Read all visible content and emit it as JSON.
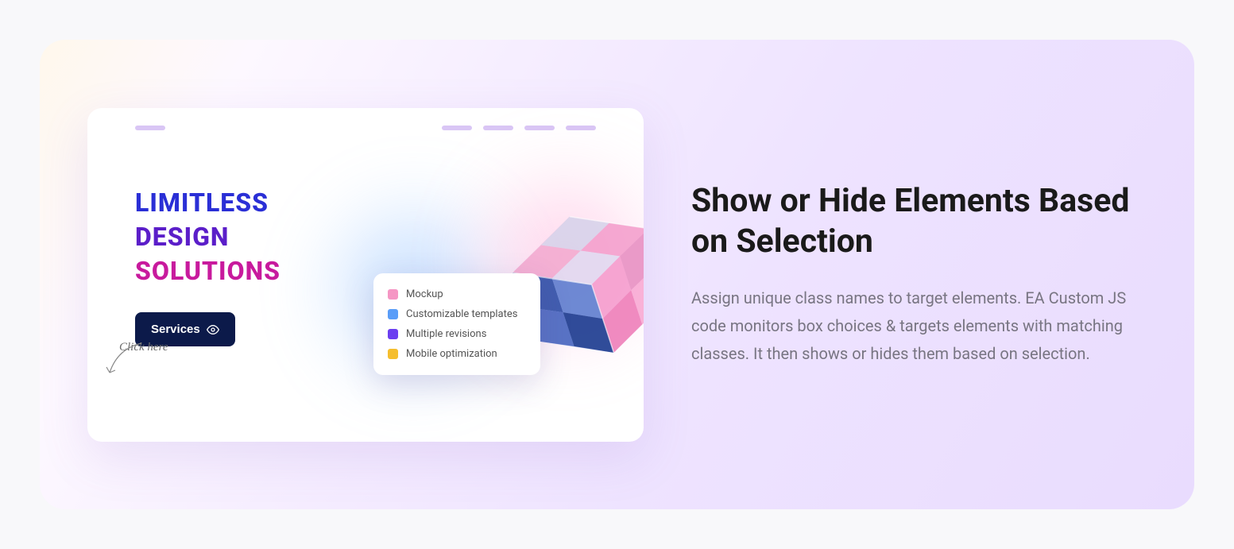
{
  "preview": {
    "hero": {
      "line1": "LIMITLESS",
      "line2": "DESIGN",
      "line3": "SOLUTIONS"
    },
    "button_label": "Services",
    "click_hint": "Click here",
    "features": [
      {
        "label": "Mockup",
        "color": "#f596c4"
      },
      {
        "label": "Customizable templates",
        "color": "#5a9df8"
      },
      {
        "label": "Multiple revisions",
        "color": "#6b3ff0"
      },
      {
        "label": "Mobile optimization",
        "color": "#f5be2e"
      }
    ]
  },
  "content": {
    "title": "Show or Hide Elements Based on Selection",
    "description": "Assign unique class names to target elements. EA Custom JS code monitors box choices & targets elements with matching classes. It then shows or hides them based on selection."
  }
}
